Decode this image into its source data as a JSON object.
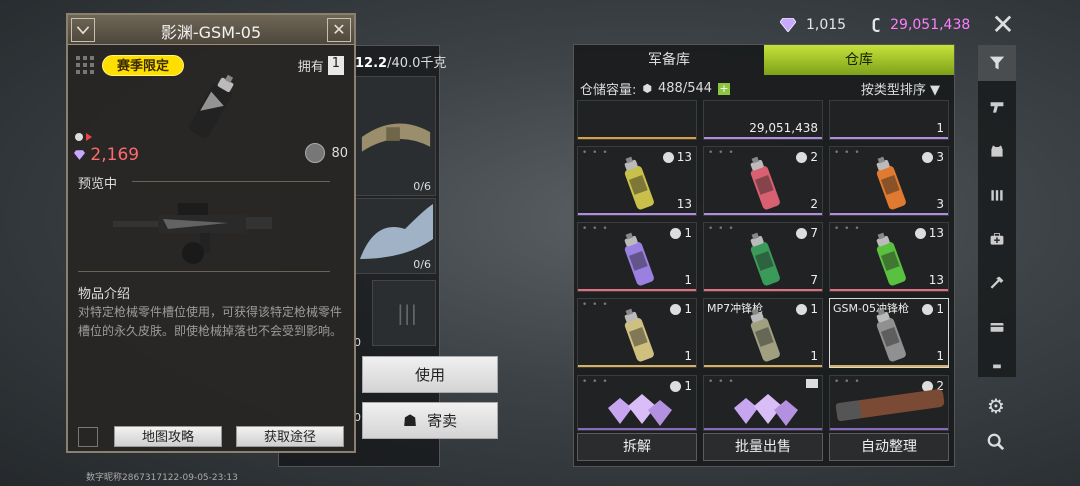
{
  "currency": {
    "gems": "1,015",
    "coins": "29,051,438"
  },
  "background_panel": {
    "weight": "12.2",
    "weight_max": "/40.0千克",
    "cells": [
      {
        "count": "0/6"
      },
      {
        "count": "0/6"
      },
      {
        "count": "0"
      },
      {
        "count": "0"
      }
    ]
  },
  "detail": {
    "title": "影渊-GSM-05",
    "badge": "赛季限定",
    "owned_label": "拥有",
    "owned_count": "1",
    "price": "2,169",
    "rep_value": "80",
    "preview_label": "预览中",
    "intro_label": "物品介绍",
    "description": "对特定枪械零件槽位使用，可获得该特定枪械零件槽位的永久皮肤。即使枪械掉落也不会受到影响。",
    "btn_map": "地图攻略",
    "btn_source": "获取途径"
  },
  "actions": {
    "use": "使用",
    "consign": "寄卖"
  },
  "warehouse": {
    "tabs": [
      "军备库",
      "仓库"
    ],
    "capacity_label": "仓储容量:",
    "capacity_value": "488/544",
    "sort_label": "按类型排序",
    "top_row": [
      {
        "qty": ""
      },
      {
        "qty": "29,051,438"
      },
      {
        "qty": "1"
      }
    ],
    "rows": [
      [
        {
          "owned": "13",
          "qty": "13",
          "color": "#b08de0",
          "can": "#c8c04a"
        },
        {
          "owned": "2",
          "qty": "2",
          "color": "#b08de0",
          "can": "#d86070"
        },
        {
          "owned": "3",
          "qty": "3",
          "color": "#b08de0",
          "can": "#e07a30"
        }
      ],
      [
        {
          "owned": "1",
          "qty": "1",
          "color": "#e07080",
          "can": "#9a80e0"
        },
        {
          "owned": "7",
          "qty": "7",
          "color": "#e07080",
          "can": "#3a9a5a"
        },
        {
          "owned": "13",
          "qty": "13",
          "color": "#e07080",
          "can": "#5ac040"
        }
      ],
      [
        {
          "owned": "1",
          "qty": "1",
          "name": "",
          "color": "#d8b060",
          "can": "#cfc080"
        },
        {
          "owned": "1",
          "qty": "1",
          "name": "MP7冲锋枪",
          "color": "#d8b060",
          "can": "#a0a080"
        },
        {
          "owned": "1",
          "qty": "1",
          "name": "GSM-05冲锋枪",
          "color": "#d8b060",
          "can": "#909090"
        }
      ],
      [
        {
          "owned": "1",
          "qty": "",
          "color": "#8a6ac0"
        },
        {
          "owned": "",
          "qty": "",
          "color": "#8a6ac0"
        },
        {
          "owned": "2",
          "qty": "",
          "color": "#8a6ac0"
        }
      ]
    ],
    "btn_dismantle": "拆解",
    "btn_bulk_sell": "批量出售",
    "btn_auto_sort": "自动整理"
  },
  "watermark": "数字昵称2867317122-09-05-23:13"
}
